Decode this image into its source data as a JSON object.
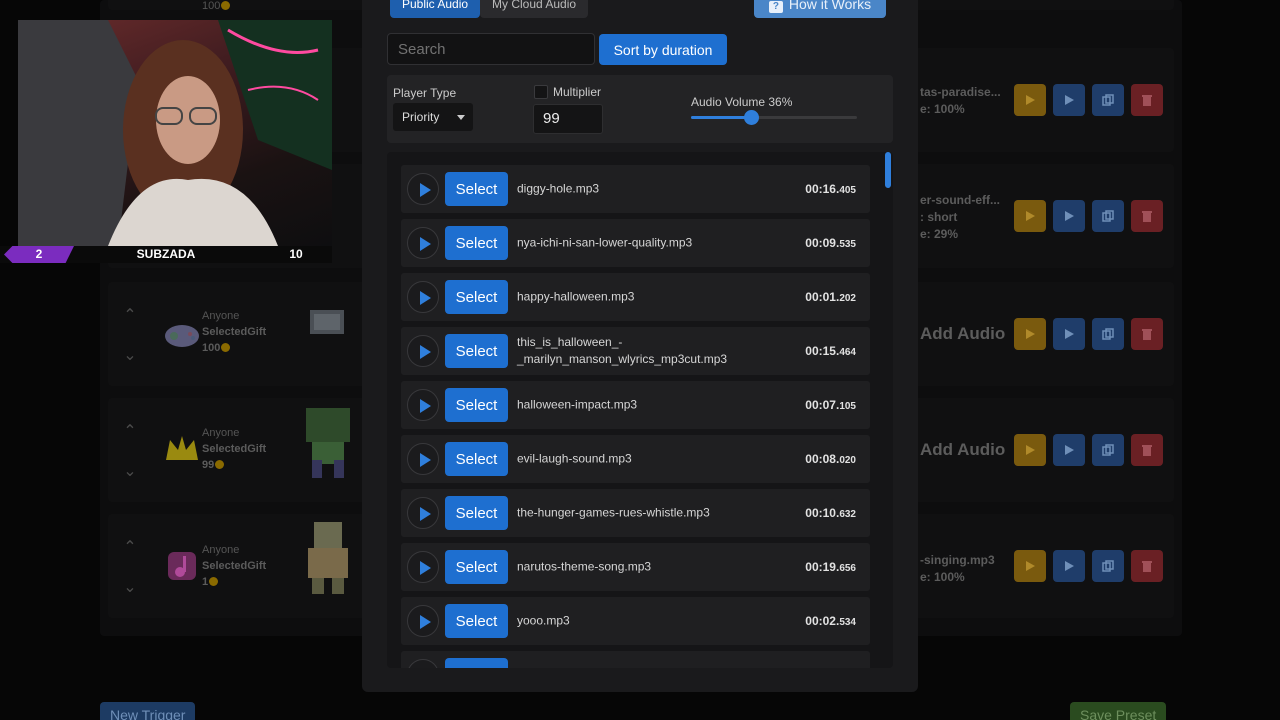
{
  "tabs": {
    "public": "Public Audio",
    "cloud": "My Cloud Audio"
  },
  "help": {
    "label": "How it Works"
  },
  "search": {
    "placeholder": "Search"
  },
  "sort": {
    "label": "Sort by duration"
  },
  "controls": {
    "player_type_label": "Player Type",
    "player_type_value": "Priority",
    "multiplier_label": "Multiplier",
    "multiplier_value": "99",
    "volume_label": "Audio Volume 36%",
    "volume_fraction": 0.36
  },
  "select_label": "Select",
  "audio_items": [
    {
      "name": "diggy-hole.mp3",
      "dur": "00:16.",
      "ms": "405"
    },
    {
      "name": "nya-ichi-ni-san-lower-quality.mp3",
      "dur": "00:09.",
      "ms": "535"
    },
    {
      "name": "happy-halloween.mp3",
      "dur": "00:01.",
      "ms": "202"
    },
    {
      "name": "this_is_halloween_-\n_marilyn_manson_wlyrics_mp3cut.mp3",
      "dur": "00:15.",
      "ms": "464"
    },
    {
      "name": "halloween-impact.mp3",
      "dur": "00:07.",
      "ms": "105"
    },
    {
      "name": "evil-laugh-sound.mp3",
      "dur": "00:08.",
      "ms": "020"
    },
    {
      "name": "the-hunger-games-rues-whistle.mp3",
      "dur": "00:10.",
      "ms": "632"
    },
    {
      "name": "narutos-theme-song.mp3",
      "dur": "00:19.",
      "ms": "656"
    },
    {
      "name": "yooo.mp3",
      "dur": "00:02.",
      "ms": "534"
    }
  ],
  "webcam": {
    "left_num": "2",
    "name": "SUBZADA",
    "right_num": "10"
  },
  "background": {
    "row0_amount": "100",
    "rows": [
      {
        "who": "Anyone",
        "gift": "SelectedGift",
        "amount": "100",
        "right": "Add Audio"
      },
      {
        "who": "Anyone",
        "gift": "SelectedGift",
        "amount": "99",
        "right": "Add Audio"
      },
      {
        "who": "Anyone",
        "gift": "SelectedGift",
        "amount": "1",
        "right": ""
      }
    ],
    "right_texts": {
      "r1a": "tas-paradise...",
      "r1b": "e: 100%",
      "r2a": "er-sound-eff...",
      "r2b": ": short",
      "r2c": "e: 29%",
      "r5a": "-singing.mp3",
      "r5b": "e: 100%"
    },
    "new_trigger": "New Trigger",
    "save_preset": "Save Preset"
  },
  "colors": {
    "accent": "#1e6fd0",
    "modal_bg": "#1a1a1c",
    "cam_badge": "#7b2cbf"
  }
}
